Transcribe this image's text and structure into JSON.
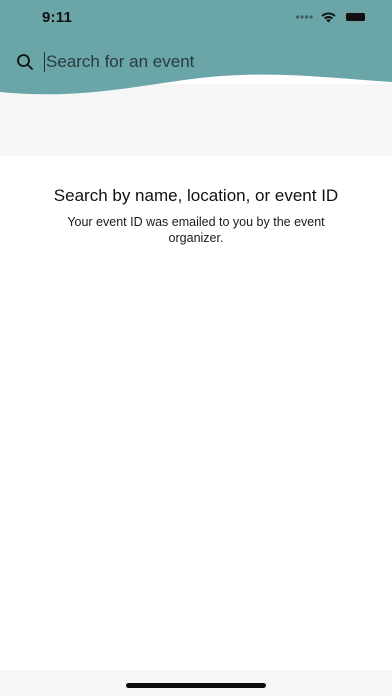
{
  "status_bar": {
    "time": "9:11",
    "icons": [
      "signal-dots-icon",
      "wifi-icon",
      "battery-icon"
    ]
  },
  "search": {
    "placeholder": "Search for an event",
    "value": "",
    "icon": "search-icon"
  },
  "empty_state": {
    "title": "Search by name, location, or event ID",
    "subtitle": "Your event ID was emailed to you by the event organizer."
  },
  "colors": {
    "header_teal": "#6aa5a8",
    "band_gray": "#f6f6f6",
    "background": "#ffffff"
  }
}
